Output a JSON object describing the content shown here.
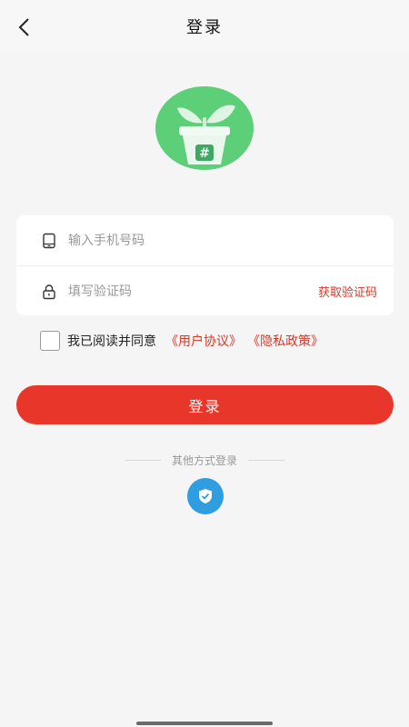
{
  "header": {
    "title": "登录",
    "back_icon": "chevron-left-icon"
  },
  "logo": {
    "icon": "plant-pot-icon",
    "symbol": "#",
    "colors": {
      "circle": "#5ccf78",
      "pot": "#e9f7ec",
      "leaf": "#dff5e4"
    }
  },
  "form": {
    "phone": {
      "icon": "phone-icon",
      "placeholder": "输入手机号码",
      "value": ""
    },
    "code": {
      "icon": "lock-icon",
      "placeholder": "填写验证码",
      "value": ""
    },
    "get_code_label": "获取验证码"
  },
  "agreement": {
    "checked": false,
    "text": "我已阅读并同意",
    "user_agreement": "《用户协议》",
    "privacy_policy": "《隐私政策》"
  },
  "login_button": "登录",
  "other_login": {
    "label": "其他方式登录",
    "icon": "shield-check-icon"
  },
  "colors": {
    "accent": "#e8372a",
    "link": "#d33a2c",
    "alt_login": "#2f9de0"
  }
}
